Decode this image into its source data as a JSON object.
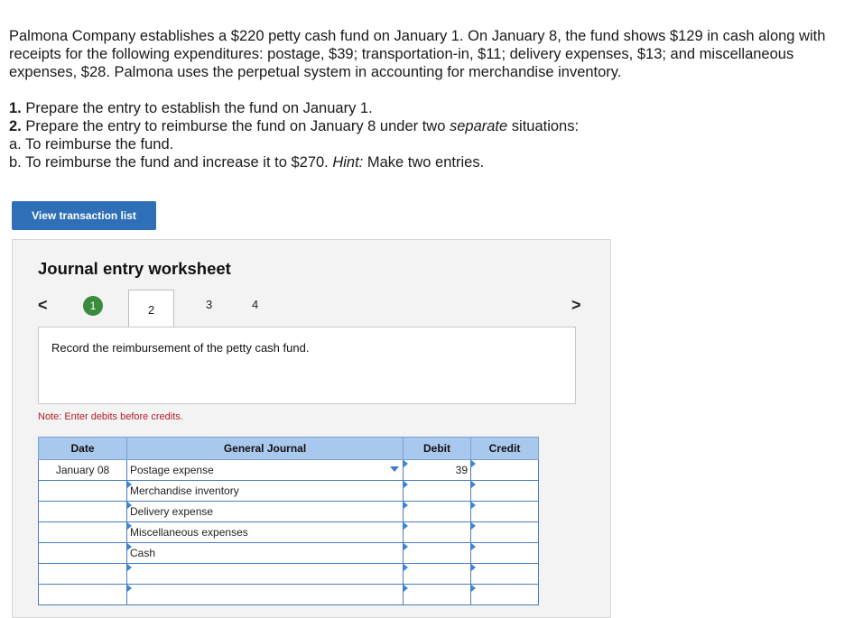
{
  "problem": {
    "intro": "Palmona Company establishes a $220 petty cash fund on January 1. On January 8, the fund shows $129 in cash along with receipts for the following expenditures: postage, $39; transportation-in, $11; delivery expenses, $13; and miscellaneous expenses, $28. Palmona uses the perpetual system in accounting for merchandise inventory.",
    "q1_num": "1.",
    "q1_text": " Prepare the entry to establish the fund on January 1.",
    "q2_num": "2.",
    "q2_text_a": " Prepare the entry to reimburse the fund on January 8 under two ",
    "q2_em": "separate",
    "q2_text_b": " situations:",
    "qa": "a. To reimburse the fund.",
    "qb_text": "b. To reimburse the fund and increase it to $270. ",
    "qb_hint": "Hint:",
    "qb_tail": " Make two entries."
  },
  "view_button": "View transaction list",
  "worksheet": {
    "title": "Journal entry worksheet",
    "steps": [
      "1",
      "2",
      "3",
      "4"
    ],
    "nav_prev": "<",
    "nav_next": ">",
    "instruction": "Record the reimbursement of the petty cash fund.",
    "note": "Note: Enter debits before credits."
  },
  "journal": {
    "headers": [
      "Date",
      "General Journal",
      "Debit",
      "Credit"
    ],
    "rows": [
      {
        "date": "January 08",
        "account": "Postage expense",
        "debit": "39",
        "credit": ""
      },
      {
        "date": "",
        "account": "Merchandise inventory",
        "debit": "",
        "credit": ""
      },
      {
        "date": "",
        "account": "Delivery expense",
        "debit": "",
        "credit": ""
      },
      {
        "date": "",
        "account": "Miscellaneous expenses",
        "debit": "",
        "credit": ""
      },
      {
        "date": "",
        "account": "Cash",
        "debit": "",
        "credit": ""
      },
      {
        "date": "",
        "account": "",
        "debit": "",
        "credit": ""
      },
      {
        "date": "",
        "account": "",
        "debit": "",
        "credit": ""
      }
    ]
  },
  "colors": {
    "button_blue": "#2f6fb7",
    "step_done_green": "#3a8b3d",
    "header_blue": "#a9c8ed",
    "note_red": "#b0202b"
  }
}
